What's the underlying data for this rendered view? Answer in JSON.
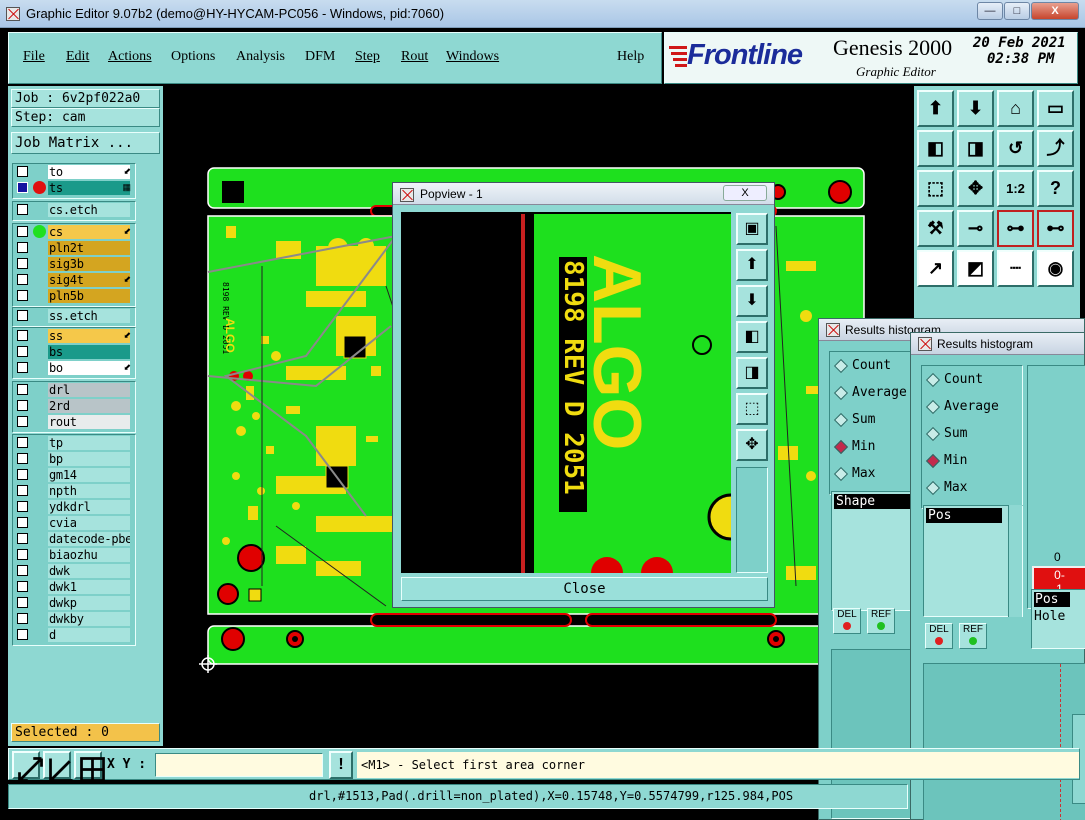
{
  "window": {
    "title": "Graphic Editor 9.07b2 (demo@HY-HYCAM-PC056 - Windows, pid:7060)",
    "minimize": "—",
    "maximize": "□",
    "close": "X"
  },
  "menu": {
    "file": "File",
    "edit": "Edit",
    "actions": "Actions",
    "options": "Options",
    "analysis": "Analysis",
    "dfm": "DFM",
    "step": "Step",
    "rout": "Rout",
    "windows": "Windows",
    "help": "Help"
  },
  "logo": {
    "brand": "Frontline",
    "product": "Genesis 2000",
    "subtitle": "Graphic Editor",
    "date": "20 Feb 2021",
    "time": "02:38 PM"
  },
  "job": {
    "job_label": "Job : 6v2pf022a0",
    "step_label": "Step: cam",
    "matrix_button": "Job Matrix ...",
    "selected": "Selected : 0"
  },
  "layers": [
    {
      "name": "to",
      "color": "#ffffff",
      "ext": "⬋",
      "circle": ""
    },
    {
      "name": "ts",
      "color": "#1a9a8a",
      "ext": "▦",
      "circle": "#e01010",
      "active": true
    },
    {
      "name": "cs.etch",
      "color": "#a6e3dd",
      "ext": "",
      "circle": ""
    },
    {
      "name": "cs",
      "color": "#f5c84a",
      "ext": "⬋",
      "circle": "#20e020"
    },
    {
      "name": "pln2t",
      "color": "#d4a520",
      "ext": "",
      "circle": ""
    },
    {
      "name": "sig3b",
      "color": "#d4a520",
      "ext": "",
      "circle": ""
    },
    {
      "name": "sig4t",
      "color": "#d4a520",
      "ext": "⬋",
      "circle": ""
    },
    {
      "name": "pln5b",
      "color": "#d4a520",
      "ext": "",
      "circle": ""
    },
    {
      "name": "ss.etch",
      "color": "#a6e3dd",
      "ext": "",
      "circle": ""
    },
    {
      "name": "ss",
      "color": "#f5c84a",
      "ext": "⬋",
      "circle": ""
    },
    {
      "name": "bs",
      "color": "#1a9a8a",
      "ext": "",
      "circle": ""
    },
    {
      "name": "bo",
      "color": "#ffffff",
      "ext": "⬋",
      "circle": ""
    },
    {
      "name": "drl",
      "color": "#b8c4c8",
      "ext": "",
      "circle": ""
    },
    {
      "name": "2rd",
      "color": "#b8c4c8",
      "ext": "",
      "circle": ""
    },
    {
      "name": "rout",
      "color": "#e8ecec",
      "ext": "",
      "circle": ""
    },
    {
      "name": "tp",
      "color": "#a6e3dd",
      "ext": "",
      "circle": ""
    },
    {
      "name": "bp",
      "color": "#a6e3dd",
      "ext": "",
      "circle": ""
    },
    {
      "name": "gm14",
      "color": "#a6e3dd",
      "ext": "",
      "circle": ""
    },
    {
      "name": "npth",
      "color": "#a6e3dd",
      "ext": "",
      "circle": ""
    },
    {
      "name": "ydkdrl",
      "color": "#a6e3dd",
      "ext": "",
      "circle": ""
    },
    {
      "name": "cvia",
      "color": "#a6e3dd",
      "ext": "",
      "circle": ""
    },
    {
      "name": "datecode-pbe",
      "color": "#a6e3dd",
      "ext": "",
      "circle": ""
    },
    {
      "name": "biaozhu",
      "color": "#a6e3dd",
      "ext": "",
      "circle": ""
    },
    {
      "name": "dwk",
      "color": "#a6e3dd",
      "ext": "",
      "circle": ""
    },
    {
      "name": "dwk1",
      "color": "#a6e3dd",
      "ext": "",
      "circle": ""
    },
    {
      "name": "dwkp",
      "color": "#a6e3dd",
      "ext": "",
      "circle": ""
    },
    {
      "name": "dwkby",
      "color": "#a6e3dd",
      "ext": "",
      "circle": ""
    },
    {
      "name": "d",
      "color": "#a6e3dd",
      "ext": "",
      "circle": ""
    }
  ],
  "board": {
    "vertical_text": "8198 REV D 2051",
    "zoom_text_1": "8198 REV D 2051",
    "zoom_text_2": "ALGO",
    "small_text": "ALGO"
  },
  "popview": {
    "title": "Popview - 1",
    "close_button": "Close",
    "close_x": "X"
  },
  "results1": {
    "title": "Results histogram",
    "options": [
      "Count",
      "Average",
      "Sum",
      "Min",
      "Max"
    ],
    "selected": "Min",
    "list_header": "Shape",
    "del": "DEL",
    "ref": "REF"
  },
  "results2": {
    "title": "Results histogram",
    "options": [
      "Count",
      "Average",
      "Sum",
      "Min",
      "Max"
    ],
    "selected": "Min",
    "list_header": "Pos",
    "del": "DEL",
    "ref": "REF",
    "axis_zero": "0",
    "bar_label": "0-\n1",
    "legend_1": "Pos",
    "legend_2": "Hole"
  },
  "bottom": {
    "xy_label": "X Y :",
    "xy_value": "",
    "warn": "!",
    "prompt": "<M1> - Select first area corner",
    "status": "drl,#1513,Pad(.drill=non_plated),X=0.15748,Y=0.5574799,r125.984,POS"
  },
  "colors": {
    "teal": "#8ed8d2",
    "board_green": "#1ee01e",
    "pad_yellow": "#f0dc10",
    "pad_red": "#e00000"
  }
}
